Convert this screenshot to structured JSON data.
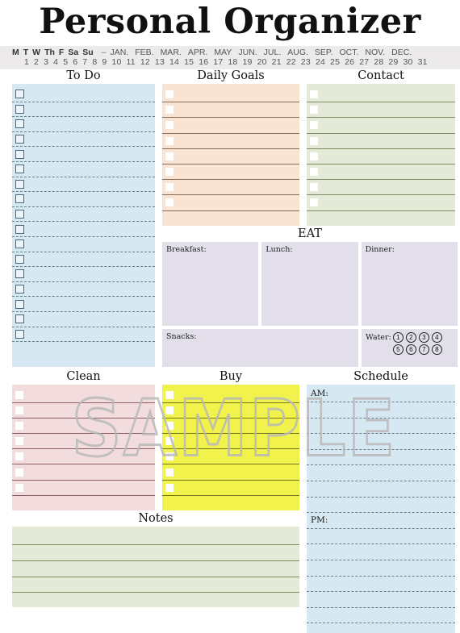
{
  "page": {
    "title": "Personal Organizer",
    "watermark": "SAMPLE"
  },
  "calendar": {
    "days": [
      "M",
      "T",
      "W",
      "Th",
      "F",
      "Sa",
      "Su"
    ],
    "separator": "–",
    "months": [
      "JAN.",
      "FEB.",
      "MAR.",
      "APR.",
      "MAY",
      "JUN.",
      "JUL.",
      "AUG.",
      "SEP.",
      "OCT.",
      "NOV.",
      "DEC."
    ],
    "dates": [
      "1",
      "2",
      "3",
      "4",
      "5",
      "6",
      "7",
      "8",
      "9",
      "10",
      "11",
      "12",
      "13",
      "14",
      "15",
      "16",
      "17",
      "18",
      "19",
      "20",
      "21",
      "22",
      "23",
      "24",
      "25",
      "26",
      "27",
      "28",
      "29",
      "30",
      "31"
    ]
  },
  "sections": {
    "todo": {
      "heading": "To Do",
      "rows": 17,
      "bg": "#d6e8f2",
      "line_style": "dashed"
    },
    "daily_goals": {
      "heading": "Daily Goals",
      "rows": 8,
      "bg": "#f9e3d2",
      "line_style": "solid"
    },
    "contact": {
      "heading": "Contact",
      "rows": 8,
      "bg": "#e4e9d8",
      "line_style": "solid"
    },
    "eat": {
      "heading": "EAT",
      "bg": "#e2deea",
      "meals": [
        {
          "label": "Breakfast:"
        },
        {
          "label": "Lunch:"
        },
        {
          "label": "Dinner:"
        }
      ],
      "snacks_label": "Snacks:",
      "water_label": "Water:",
      "water_marks": [
        "1",
        "2",
        "3",
        "4",
        "5",
        "6",
        "7",
        "8"
      ]
    },
    "clean": {
      "heading": "Clean",
      "rows": 7,
      "bg": "#f3dcdd",
      "line_style": "solid"
    },
    "buy": {
      "heading": "Buy",
      "rows": 7,
      "bg": "#f2f24d",
      "line_style": "solid"
    },
    "schedule": {
      "heading": "Schedule",
      "am_label": "AM:",
      "pm_label": "PM:",
      "bg": "#d6e8f2",
      "line_style": "dashed",
      "am_rows": 7,
      "pm_rows": 6
    },
    "notes": {
      "heading": "Notes",
      "rows": 4,
      "bg": "#e4e9d8",
      "line_style": "solid"
    }
  }
}
